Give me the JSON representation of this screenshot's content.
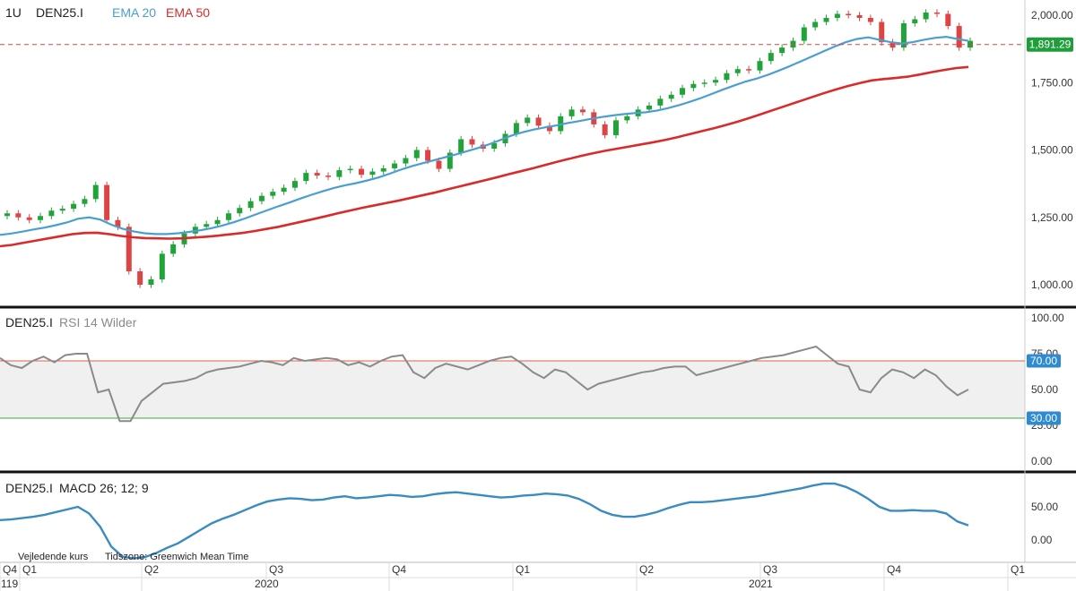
{
  "header": {
    "interval": "1U",
    "symbol": "DEN25.I",
    "ema20_label": "EMA 20",
    "ema50_label": "EMA 50"
  },
  "colors": {
    "up": "#22a33a",
    "down": "#dd4444",
    "ema20": "#4a9fd0",
    "ema50": "#d92b2b",
    "rsi": "#8a8a8a",
    "macd": "#3a8cc0",
    "rsi_upper": "#e06050",
    "rsi_lower": "#3aa845",
    "price_badge": "#1f9d3a",
    "rsi_badge": "#2e8bd1"
  },
  "price_panel": {
    "current_price_label": "1,891.29",
    "current_price": 1891.29,
    "y_ticks": [
      "2,000.00",
      "1,750.00",
      "1,500.00",
      "1,250.00",
      "1,000.00"
    ]
  },
  "rsi_panel": {
    "symbol": "DEN25.I",
    "label": "RSI 14 Wilder",
    "y_ticks": [
      "100.00",
      "75.00",
      "50.00",
      "25.00",
      "0.00"
    ],
    "upper_label": "70.00",
    "lower_label": "30.00"
  },
  "macd_panel": {
    "symbol": "DEN25.I",
    "label": "MACD 26; 12; 9",
    "y_ticks": [
      "50.00",
      "0.00"
    ],
    "footer_left": "Vejledende kurs",
    "footer_tz": "Tidszone: Greenwich Mean Time"
  },
  "x_axis": {
    "quarters": [
      "Q4",
      "Q1",
      "Q2",
      "Q3",
      "Q4",
      "Q1",
      "Q2",
      "Q3",
      "Q4",
      "Q1"
    ],
    "years": [
      "119",
      "2020",
      "2021"
    ]
  },
  "chart_data": [
    {
      "type": "candlestick",
      "series": [
        {
          "name": "EMA 20",
          "values": [
            1185,
            1190,
            1197,
            1205,
            1212,
            1221,
            1231,
            1245,
            1250,
            1242,
            1223,
            1208,
            1198,
            1191,
            1188,
            1188,
            1191,
            1196,
            1202,
            1210,
            1220,
            1232,
            1246,
            1261,
            1276,
            1291,
            1305,
            1320,
            1334,
            1347,
            1359,
            1369,
            1377,
            1387,
            1398,
            1412,
            1427,
            1440,
            1451,
            1462,
            1473,
            1484,
            1496,
            1508,
            1522,
            1538,
            1554,
            1566,
            1576,
            1584,
            1591,
            1600,
            1607,
            1615,
            1622,
            1628,
            1633,
            1637,
            1640,
            1646,
            1655,
            1666,
            1679,
            1693,
            1709,
            1725,
            1740,
            1754,
            1765,
            1779,
            1795,
            1812,
            1830,
            1848,
            1866,
            1884,
            1900,
            1912,
            1918,
            1909,
            1900,
            1895,
            1900,
            1909,
            1916,
            1920,
            1912,
            1905
          ]
        },
        {
          "name": "EMA 50",
          "values": [
            1143,
            1148,
            1156,
            1164,
            1172,
            1180,
            1188,
            1192,
            1193,
            1188,
            1181,
            1176,
            1173,
            1172,
            1171,
            1172,
            1175,
            1178,
            1182,
            1187,
            1192,
            1199,
            1207,
            1215,
            1225,
            1235,
            1245,
            1255,
            1266,
            1276,
            1286,
            1295,
            1304,
            1313,
            1323,
            1333,
            1343,
            1354,
            1365,
            1376,
            1387,
            1398,
            1410,
            1421,
            1432,
            1444,
            1456,
            1467,
            1478,
            1488,
            1497,
            1505,
            1513,
            1521,
            1529,
            1538,
            1548,
            1559,
            1570,
            1581,
            1593,
            1606,
            1620,
            1635,
            1650,
            1665,
            1680,
            1695,
            1710,
            1724,
            1737,
            1748,
            1758,
            1763,
            1767,
            1772,
            1780,
            1789,
            1797,
            1804,
            1808
          ]
        }
      ],
      "x_ticks": [
        "Q4",
        "Q1",
        "Q2",
        "Q3",
        "Q4",
        "Q1",
        "Q2",
        "Q3",
        "Q4",
        "Q1"
      ],
      "ylim": [
        940,
        2050
      ],
      "current_price": 1891.29
    },
    {
      "type": "line",
      "series": [
        {
          "name": "RSI 14 Wilder",
          "values": [
            72,
            67,
            65,
            70,
            73,
            69,
            74,
            75,
            75,
            48,
            50,
            28,
            28,
            42,
            48,
            54,
            55,
            56,
            58,
            62,
            64,
            65,
            66,
            68,
            70,
            69,
            67,
            72,
            70,
            71,
            72,
            71,
            67,
            69,
            66,
            70,
            73,
            74,
            62,
            58,
            65,
            68,
            66,
            64,
            67,
            70,
            72,
            73,
            68,
            62,
            58,
            64,
            62,
            56,
            50,
            54,
            56,
            58,
            60,
            62,
            63,
            65,
            66,
            66,
            60,
            62,
            64,
            66,
            68,
            70,
            72,
            73,
            74,
            76,
            78,
            80,
            74,
            68,
            66,
            50,
            48,
            58,
            64,
            62,
            58,
            64,
            60,
            52,
            46,
            50
          ]
        }
      ],
      "levels": [
        70,
        30
      ],
      "ylim": [
        0,
        100
      ],
      "x_ticks": [
        "Q4",
        "Q1",
        "Q2",
        "Q3",
        "Q4",
        "Q1",
        "Q2",
        "Q3",
        "Q4",
        "Q1"
      ]
    },
    {
      "type": "line",
      "series": [
        {
          "name": "MACD 26; 12; 9",
          "values": [
            30,
            31,
            33,
            35,
            38,
            42,
            46,
            50,
            40,
            20,
            -10,
            -25,
            -28,
            -26,
            -20,
            -12,
            -5,
            5,
            15,
            25,
            32,
            38,
            45,
            52,
            58,
            61,
            63,
            62,
            60,
            61,
            64,
            66,
            63,
            64,
            66,
            68,
            67,
            65,
            66,
            69,
            71,
            72,
            70,
            68,
            66,
            64,
            65,
            67,
            68,
            70,
            69,
            67,
            62,
            54,
            44,
            38,
            35,
            35,
            38,
            42,
            48,
            53,
            57,
            57,
            58,
            60,
            62,
            64,
            66,
            69,
            72,
            75,
            78,
            82,
            85,
            85,
            80,
            72,
            62,
            50,
            44,
            44,
            45,
            44,
            44,
            40,
            28,
            22
          ]
        }
      ],
      "ylim": [
        -50,
        100
      ],
      "x_ticks": [
        "Q4",
        "Q1",
        "Q2",
        "Q3",
        "Q4",
        "Q1",
        "Q2",
        "Q3",
        "Q4",
        "Q1"
      ]
    }
  ]
}
